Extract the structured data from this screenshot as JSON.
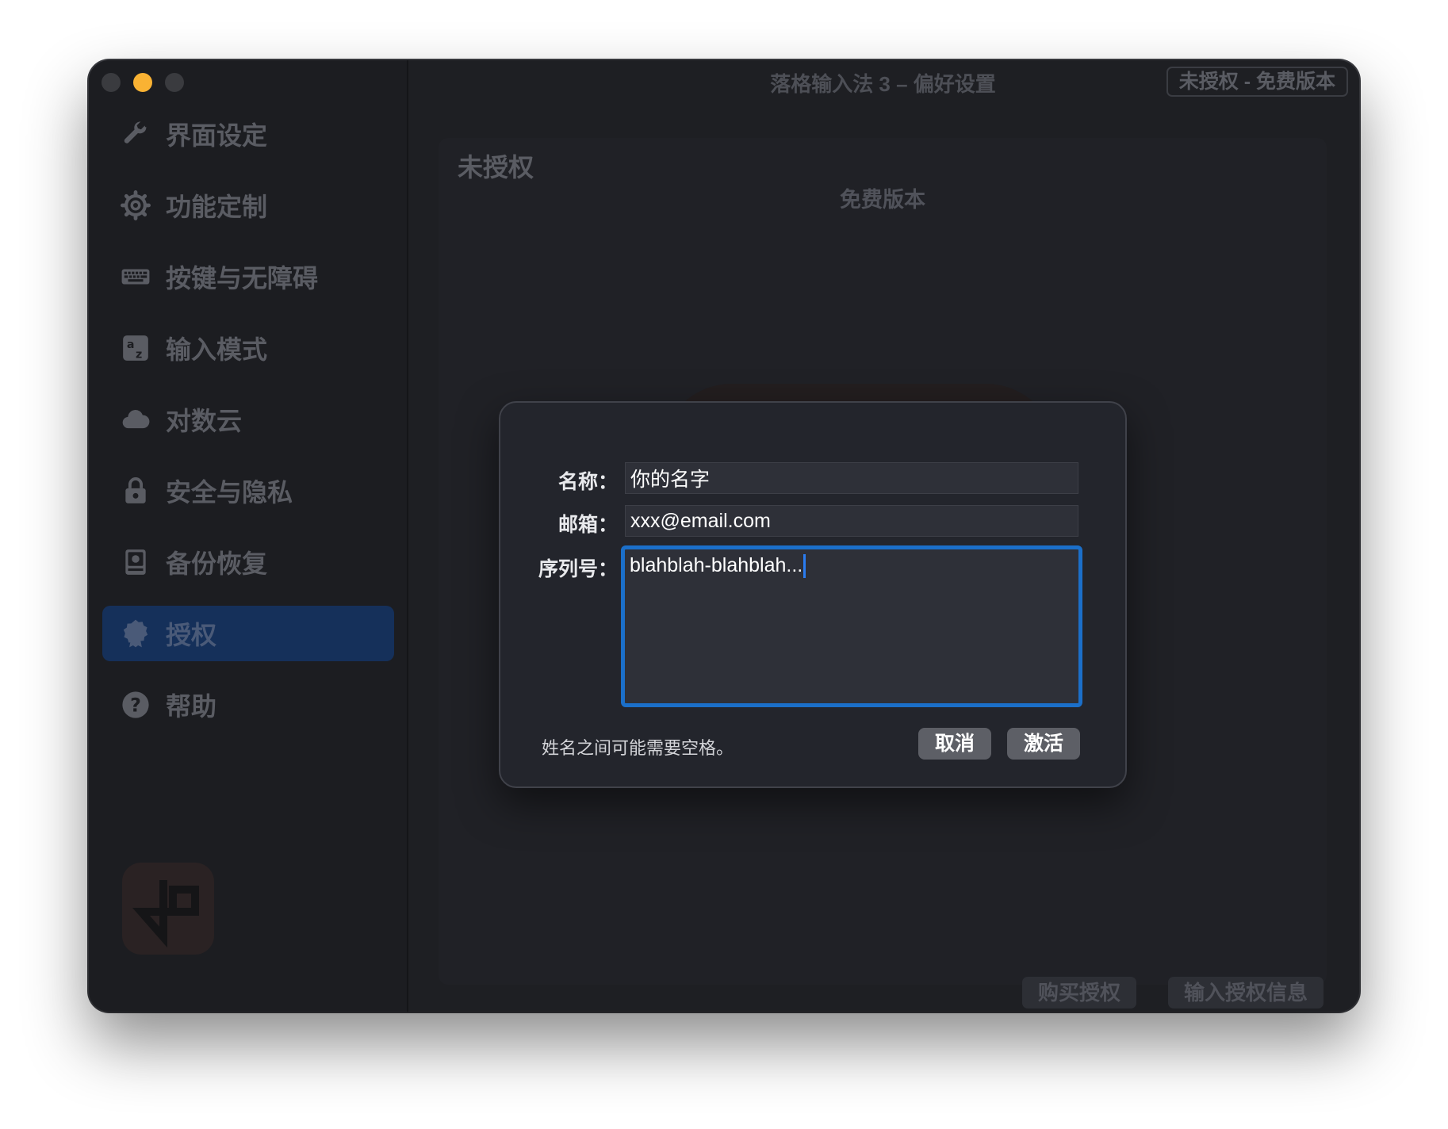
{
  "window": {
    "title": "落格输入法 3 – 偏好设置",
    "badge": "未授权 - 免费版本"
  },
  "sidebar": {
    "items": [
      {
        "label": "界面设定",
        "icon": "wrench-icon"
      },
      {
        "label": "功能定制",
        "icon": "gear-icon"
      },
      {
        "label": "按键与无障碍",
        "icon": "keyboard-icon"
      },
      {
        "label": "输入模式",
        "icon": "input-mode-icon"
      },
      {
        "label": "对数云",
        "icon": "cloud-icon"
      },
      {
        "label": "安全与隐私",
        "icon": "lock-icon"
      },
      {
        "label": "备份恢复",
        "icon": "backup-drive-icon"
      },
      {
        "label": "授权",
        "icon": "badge-seal-icon",
        "active": true
      },
      {
        "label": "帮助",
        "icon": "help-circle-icon"
      }
    ]
  },
  "panel": {
    "title": "未授权",
    "subtitle": "免费版本",
    "buy_button": "购买授权",
    "enter_button": "输入授权信息"
  },
  "dialog": {
    "name_label": "名称：",
    "name_value": "你的名字",
    "email_label": "邮箱：",
    "email_value": "xxx@email.com",
    "serial_label": "序列号：",
    "serial_value": "blahblah-blahblah...",
    "hint": "姓名之间可能需要空格。",
    "cancel_button": "取消",
    "activate_button": "激活"
  },
  "colors": {
    "accent": "#1b6fc9",
    "sidebar_active": "#15305a",
    "minimize": "#f9b233"
  }
}
